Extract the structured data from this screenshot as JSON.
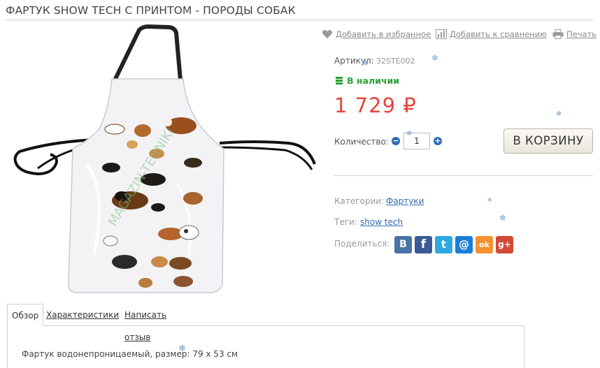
{
  "page": {
    "title": "ФАРТУК SHOW TECH С ПРИНТОМ - ПОРОДЫ СОБАК"
  },
  "actions": {
    "favorite_label": "Добавить в избранное",
    "compare_label": "Добавить к сравнению",
    "print_label": "Печать"
  },
  "product": {
    "sku_label": "Артикул:",
    "sku_value": "32STE002",
    "stock_label": "В наличии",
    "price": "1 729 ₽",
    "quantity_label": "Количество:",
    "quantity_value": "1",
    "cart_button": "В КОРЗИНУ",
    "watermark": "MAGAZIN-TEHNIKI"
  },
  "meta": {
    "categories_label": "Категории:",
    "categories_value": "Фартуки",
    "tags_label": "Теги:",
    "tags_value": "show tech",
    "share_label": "Поделиться:"
  },
  "share_buttons": [
    {
      "network": "vkontakte",
      "glyph": "B",
      "color": "#4a73a6"
    },
    {
      "network": "facebook",
      "glyph": "f",
      "color": "#3b5998"
    },
    {
      "network": "twitter",
      "glyph": "t",
      "color": "#2fa8df"
    },
    {
      "network": "mail",
      "glyph": "@",
      "color": "#1a7fd4"
    },
    {
      "network": "odnoklassniki",
      "glyph": "ok",
      "color": "#f59330"
    },
    {
      "network": "google-plus",
      "glyph": "g+",
      "color": "#d34836"
    }
  ],
  "tabs": [
    {
      "label": "Обзор",
      "active": true
    },
    {
      "label": "Характеристики",
      "active": false
    },
    {
      "label": "Написать отзыв",
      "active": false
    }
  ],
  "description": "Фартук водонепроницаемый, размер: 79 х 53 см",
  "icons": {
    "favorite": "heart-icon",
    "compare": "bar-chart-icon",
    "print": "printer-icon",
    "stock": "stock-bars-icon",
    "qty_minus": "minus-circle-icon",
    "qty_plus": "plus-circle-icon"
  },
  "colors": {
    "price": "#e8443a",
    "stock": "#2aa336",
    "link": "#2f6db3",
    "snowflake": "#6fa0d8"
  }
}
